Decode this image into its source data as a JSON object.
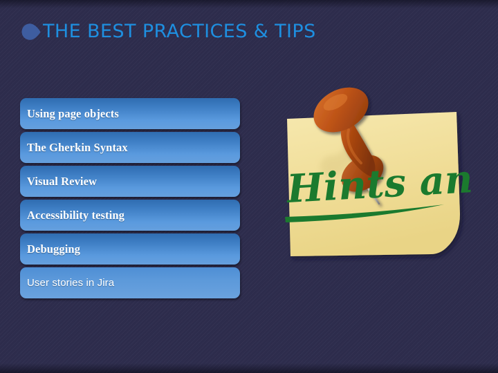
{
  "slide": {
    "background_color": "#2e2d4e",
    "title": {
      "text": "THE BEST PRACTICES & TIPS",
      "color": "#1e8fe0",
      "bullet_icon": "leaf-bullet-icon",
      "bullet_color": "#3c5a9a"
    },
    "bullets": [
      {
        "label": "Using page objects"
      },
      {
        "label": "The Gherkin Syntax"
      },
      {
        "label": "Visual Review"
      },
      {
        "label": "Accessibility testing"
      },
      {
        "label": "Debugging"
      },
      {
        "label": "User stories in Jira"
      }
    ],
    "bullet_box_color_top": "#2f6cb0",
    "bullet_box_color_bottom": "#659fdd",
    "bullet_text_color": "#ffffff",
    "artwork": {
      "name": "sticky-note-with-pushpin",
      "note_text": "Hints and Tips",
      "note_color": "#f1e09a",
      "note_text_color": "#1b7a2e",
      "underline_color": "#1b7a2e",
      "pushpin_color": "#c2561b"
    }
  }
}
